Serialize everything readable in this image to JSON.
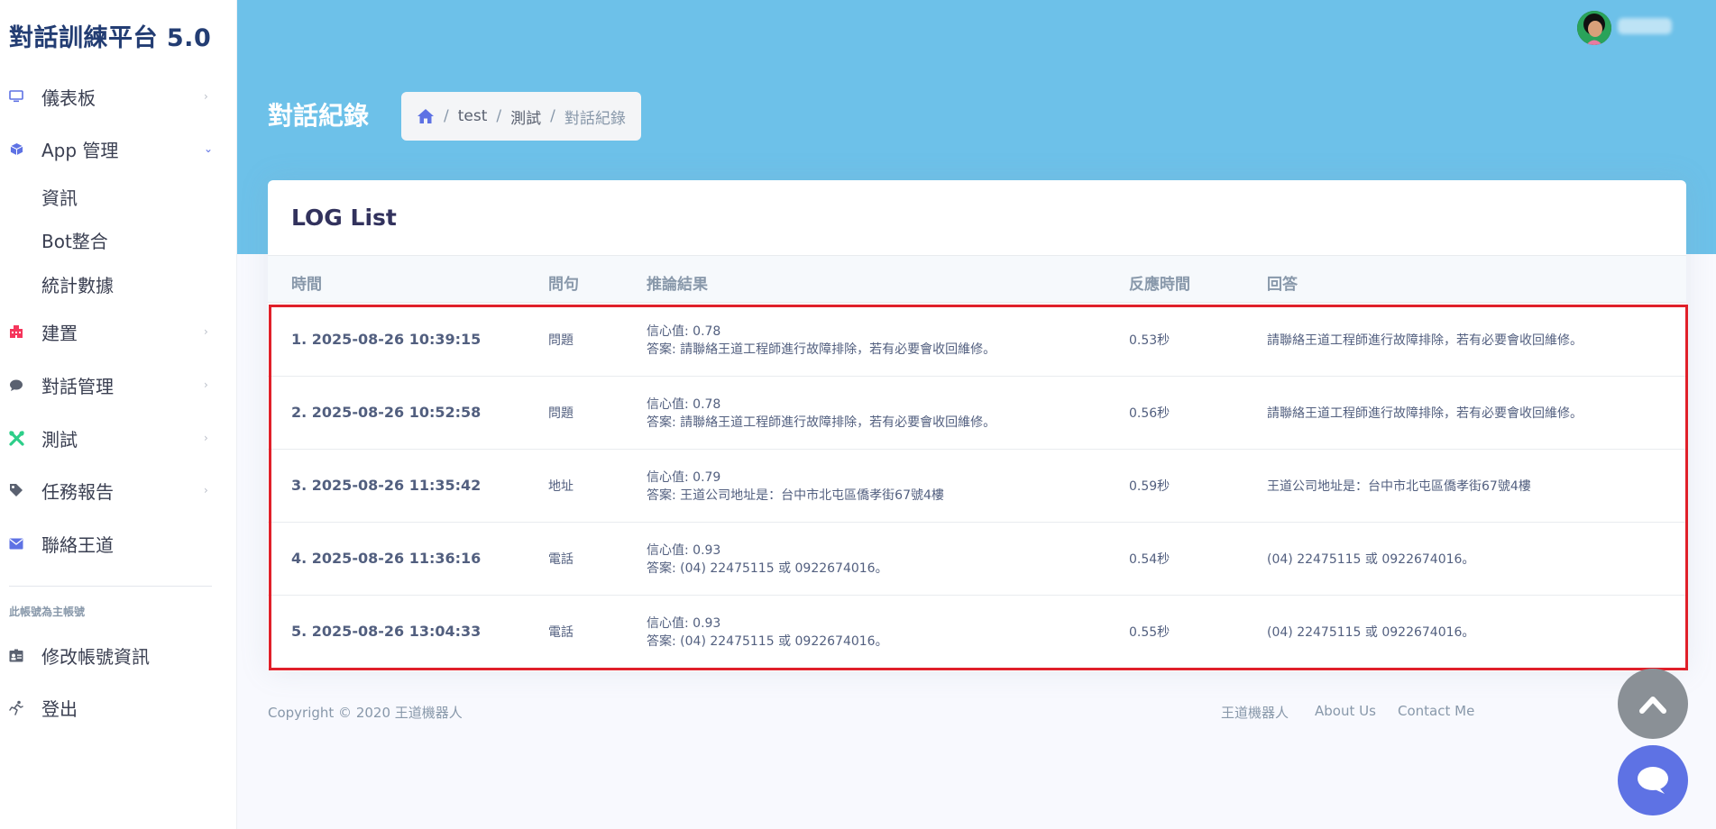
{
  "app": {
    "brand": "對話訓練平台 5.0"
  },
  "sidebar": {
    "items": [
      {
        "label": "儀表板",
        "icon": "monitor-icon"
      },
      {
        "label": "App 管理",
        "icon": "cube-icon"
      },
      {
        "label": "建置",
        "icon": "building-icon"
      },
      {
        "label": "對話管理",
        "icon": "chat-bubble-icon"
      },
      {
        "label": "測試",
        "icon": "tools-icon"
      },
      {
        "label": "任務報告",
        "icon": "tag-icon"
      },
      {
        "label": "聯絡王道",
        "icon": "envelope-icon"
      }
    ],
    "sub_items": [
      "資訊",
      "Bot整合",
      "統計數據"
    ],
    "account_heading": "此帳號為主帳號",
    "account_items": [
      {
        "label": "修改帳號資訊",
        "icon": "id-card-icon"
      },
      {
        "label": "登出",
        "icon": "running-icon"
      }
    ]
  },
  "header": {
    "page_title": "對話紀錄",
    "breadcrumb": [
      "test",
      "測試",
      "對話紀錄"
    ]
  },
  "log_card": {
    "title": "LOG List",
    "columns": [
      "時間",
      "問句",
      "推論結果",
      "反應時間",
      "回答"
    ],
    "rows": [
      {
        "time": "1. 2025-08-26 10:39:15",
        "question": "問題",
        "confidence": "信心值: 0.78",
        "inference_answer": "答案: 請聯絡王道工程師進行故障排除，若有必要會收回維修。",
        "response_time": "0.53秒",
        "answer": "請聯絡王道工程師進行故障排除，若有必要會收回維修。"
      },
      {
        "time": "2. 2025-08-26 10:52:58",
        "question": "問題",
        "confidence": "信心值: 0.78",
        "inference_answer": "答案: 請聯絡王道工程師進行故障排除，若有必要會收回維修。",
        "response_time": "0.56秒",
        "answer": "請聯絡王道工程師進行故障排除，若有必要會收回維修。"
      },
      {
        "time": "3. 2025-08-26 11:35:42",
        "question": "地址",
        "confidence": "信心值: 0.79",
        "inference_answer": "答案: 王道公司地址是：台中市北屯區僑孝街67號4樓",
        "response_time": "0.59秒",
        "answer": "王道公司地址是：台中市北屯區僑孝街67號4樓"
      },
      {
        "time": "4. 2025-08-26 11:36:16",
        "question": "電話",
        "confidence": "信心值: 0.93",
        "inference_answer": "答案: (04) 22475115 或 0922674016。",
        "response_time": "0.54秒",
        "answer": "(04) 22475115 或 0922674016。"
      },
      {
        "time": "5. 2025-08-26 13:04:33",
        "question": "電話",
        "confidence": "信心值: 0.93",
        "inference_answer": "答案: (04) 22475115 或 0922674016。",
        "response_time": "0.55秒",
        "answer": "(04) 22475115 或 0922674016。"
      }
    ]
  },
  "footer": {
    "copyright": "Copyright © 2020 王道機器人",
    "links": [
      "王道機器人",
      "About Us",
      "Contact Me"
    ]
  },
  "colors": {
    "hero": "#6dc1e9",
    "brand": "#233d73",
    "accent": "#5e72e4",
    "highlight": "#e0202a"
  }
}
